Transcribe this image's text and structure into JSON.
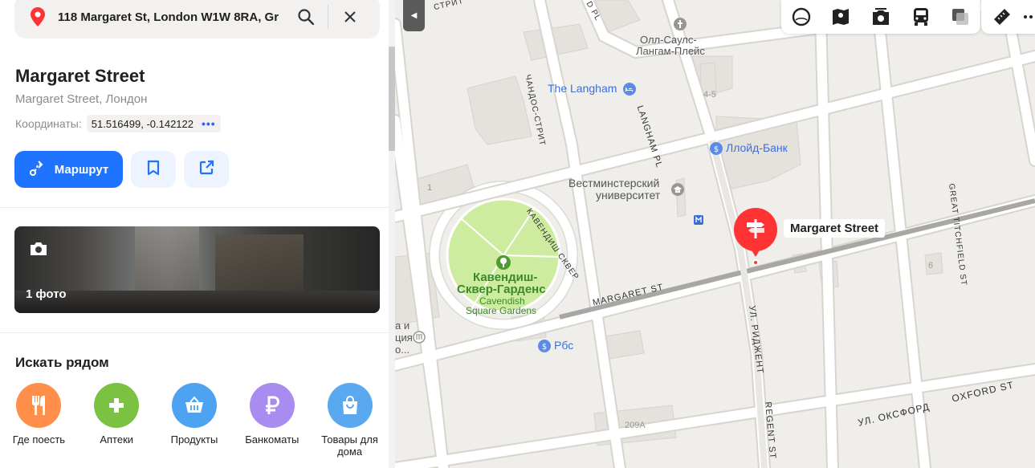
{
  "search": {
    "value": "118 Margaret St, London W1W 8RA, Gr"
  },
  "place": {
    "title": "Margaret Street",
    "subtitle": "Margaret Street, Лондон",
    "coords_label": "Координаты:",
    "coords_value": "51.516499, -0.142122",
    "more": "•••"
  },
  "actions": {
    "route_label": "Маршрут"
  },
  "photo": {
    "count_label": "1 фото"
  },
  "nearby": {
    "title": "Искать рядом",
    "items": [
      {
        "label": "Где поесть",
        "icon": "fork-knife-icon",
        "color": "#ff8f4a"
      },
      {
        "label": "Аптеки",
        "icon": "plus-icon",
        "color": "#7bc142"
      },
      {
        "label": "Продукты",
        "icon": "basket-icon",
        "color": "#4da2f2"
      },
      {
        "label": "Банкоматы",
        "icon": "ruble-icon",
        "color": "#a98cf0"
      },
      {
        "label": "Товары для дома",
        "icon": "bag-icon",
        "color": "#5aa9f0"
      }
    ]
  },
  "map": {
    "marker_label": "Margaret Street",
    "labels": {
      "olla": "Олл-Саулс-",
      "olla2": "Лангам-Плейс",
      "langham": "The Langham",
      "lloyd": "Ллойд-Банк",
      "westminster1": "Вестминстерский",
      "westminster2": "университет",
      "garden1": "Кавендиш-",
      "garden2": "Сквер-Гарденс",
      "garden3": "Cavendish",
      "garden4": "Square Gardens",
      "rbs": "Рбс",
      "langham_pl": "LANGHAM PL",
      "chandos": "ЧАНДОС-СТРИТ",
      "cavendish_sq": "КАВЕНДИШ СКВЕР",
      "margaret_st": "MARGARET ST",
      "regent_ru": "УЛ. РИДЖЕНТ",
      "regent_en": "REGENT ST",
      "oxford_ru": "УЛ. ОКСФОРД",
      "oxford_en": "OXFORD ST",
      "great_titchfield": "GREAT TITCHFIELD ST",
      "strit": "СТРИТ",
      "d_pl": "D PL",
      "n45": "4-5",
      "n1": "1",
      "n6": "6",
      "n209a": "209A",
      "left_frag1": "а и",
      "left_frag2": "ция",
      "left_frag3": "о..."
    }
  },
  "colors": {
    "accent": "#1e73ff",
    "marker": "#ff3333",
    "park": "#cdeca0",
    "road": "#ffffff"
  }
}
